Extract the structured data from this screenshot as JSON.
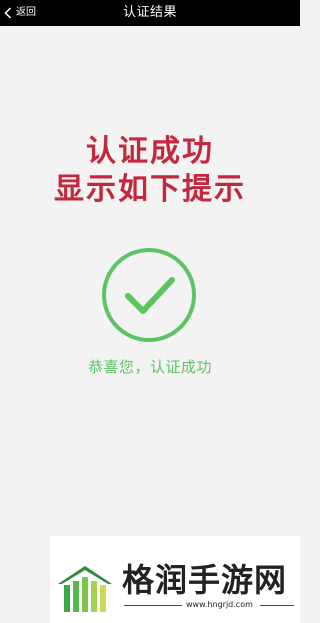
{
  "header": {
    "back_label": "返回",
    "title": "认证结果"
  },
  "main": {
    "headline_line1": "认证成功",
    "headline_line2": "显示如下提示",
    "success_message": "恭喜您，认证成功",
    "icon": "check-circle-icon"
  },
  "watermark": {
    "name": "格润手游网",
    "url": "www.hngrjd.com"
  },
  "colors": {
    "topbar": "#000000",
    "background": "#f3f3f3",
    "headline": "#c4283d",
    "success": "#5cc461"
  }
}
